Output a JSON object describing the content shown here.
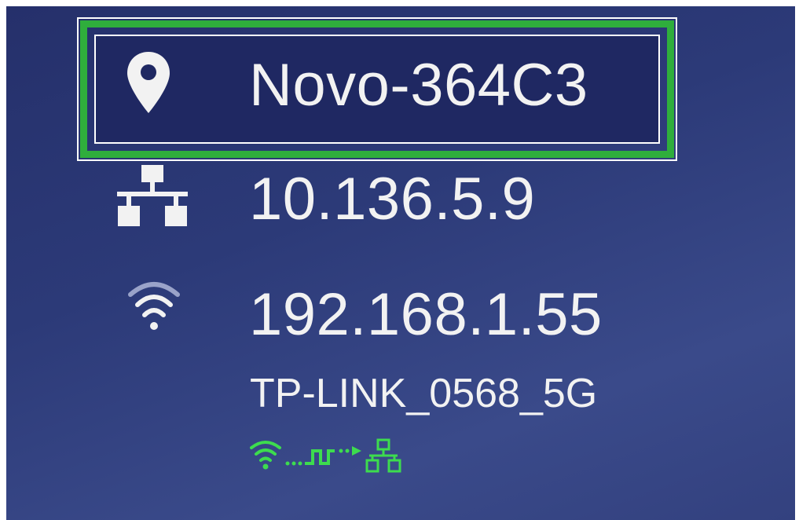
{
  "device": {
    "name": "Novo-364C3",
    "name_icon": "location-pin-icon",
    "lan_ip": "10.136.5.9",
    "lan_icon": "network-icon",
    "wifi_ip": "192.168.1.55",
    "wifi_icon": "wifi-icon",
    "wifi_ssid": "TP-LINK_0568_5G",
    "status_icon": "wifi-to-network-bridge-icon"
  },
  "colors": {
    "background": "#2c3a78",
    "highlight": "#2fae3c",
    "text": "#f2f2f2",
    "status": "#3ddc4e"
  }
}
